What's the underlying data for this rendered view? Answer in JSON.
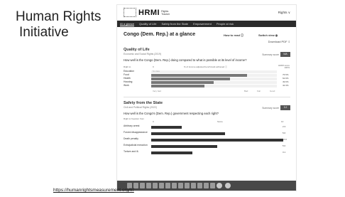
{
  "slide": {
    "title_line1": "Human Rights",
    "title_line2": "Initiative",
    "link": "https://humanrightsmeasurement.org/fr/"
  },
  "site": {
    "logo": "HRMI",
    "logo_sub1": "Rights",
    "logo_sub2": "Tracker",
    "lang": "Rights ∨",
    "nav": [
      "At a glance",
      "Quality of Life",
      "Safety from the State",
      "Empowerment",
      "People at risk"
    ],
    "page_title": "Congo (Dem. Rep.) at a glance",
    "how_to_read": "How to read ⓘ",
    "switch_view": "Switch view ◍",
    "download": "Download PDF ⇩"
  },
  "quality_of_life": {
    "title": "Quality of Life",
    "subtitle": "Economic and Social Rights (2019)",
    "question": "How well is the Congo (Dem. Rep.) doing compared to what is possible at its level of income?",
    "summary_label": "Summary score",
    "summary_badge": "N/A",
    "axis_left_line1": "Right to",
    "axis_tick0": "0",
    "axis_mid": "% of income adjusted benchmark achieved ⓘ",
    "axis_right_line1": "HRMI score",
    "axis_right_line2": "100%",
    "rows": [
      {
        "label": "Education",
        "value": null,
        "display": "",
        "nodata": "No data"
      },
      {
        "label": "Food",
        "value": 76.5,
        "display": "76.5%",
        "nodata": ""
      },
      {
        "label": "Health",
        "value": 62.9,
        "display": "62.9%",
        "nodata": ""
      },
      {
        "label": "Housing",
        "value": 49.6,
        "display": "49.6%",
        "nodata": ""
      },
      {
        "label": "Work",
        "value": 42.3,
        "display": "42.3%",
        "nodata": ""
      }
    ],
    "bottom_axis": [
      "Very bad",
      "Bad",
      "Fair",
      "Good"
    ]
  },
  "safety": {
    "title": "Safety from the State",
    "subtitle": "Civil and Political Rights (2022)",
    "question": "How well is the Congo's (Dem. Rep.) government respecting each right?",
    "summary_label": "Summary score",
    "summary_badge": "3.2",
    "axis_left": "Right to freedom from",
    "axis_tick0": "0",
    "axis_mid": "Score",
    "axis_max": "10",
    "rows": [
      {
        "label": "Arbitrary arrest",
        "value": 2.3,
        "display": "2.3"
      },
      {
        "label": "Forced disappearance",
        "value": 5.6,
        "display": "5.6"
      },
      {
        "label": "Death penalty",
        "value": 10.0,
        "display": "10.0"
      },
      {
        "label": "Extrajudicial execution",
        "value": 5.0,
        "display": "5.0"
      },
      {
        "label": "Torture and ill-",
        "value": 3.1,
        "display": "3.1"
      }
    ]
  }
}
